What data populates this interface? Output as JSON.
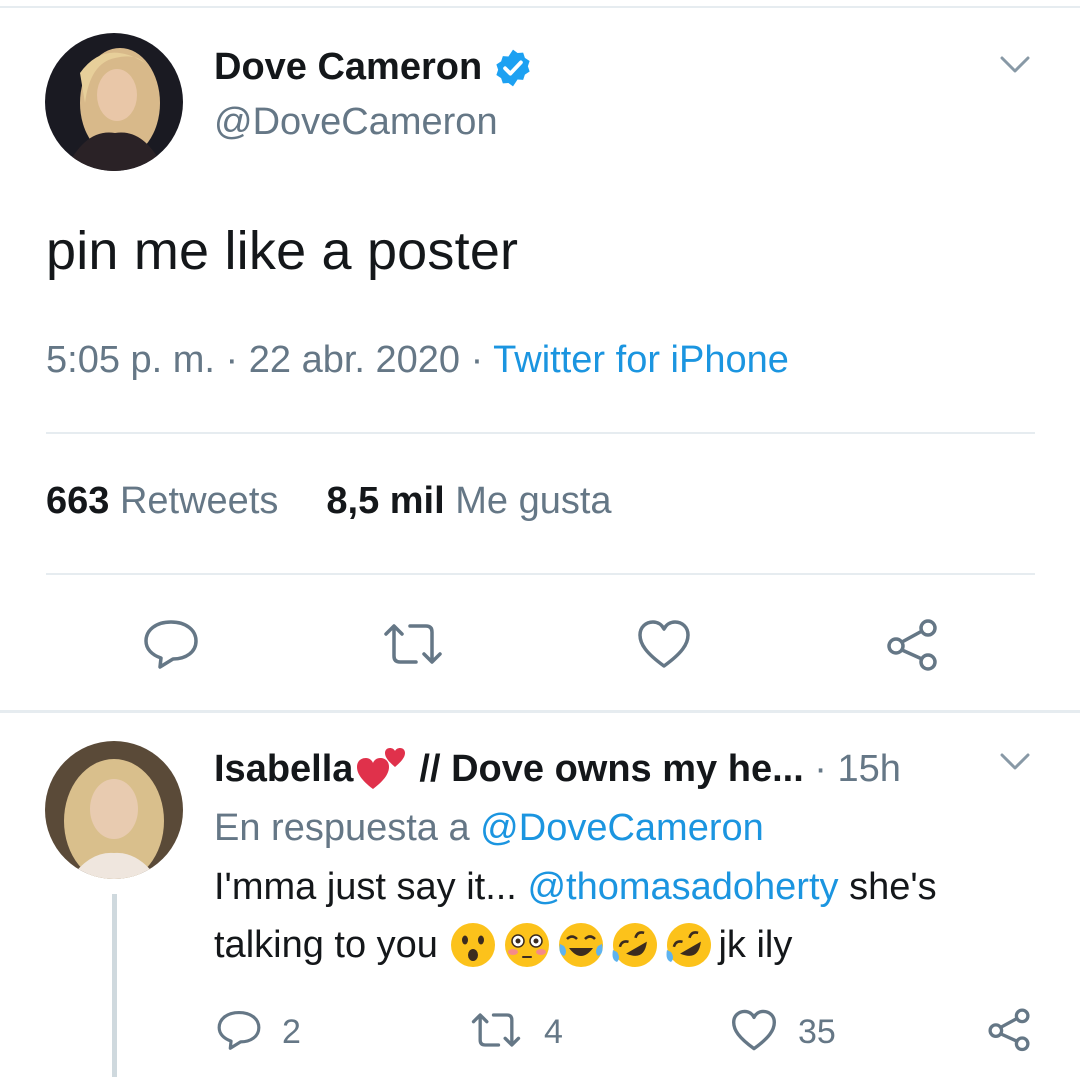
{
  "tweet": {
    "display_name": "Dove Cameron",
    "handle": "@DoveCameron",
    "text": "pin me like a poster",
    "time": "5:05 p. m.",
    "date": "22 abr. 2020",
    "source": "Twitter for iPhone",
    "retweet_count": "663",
    "retweet_label": "Retweets",
    "like_count": "8,5 mil",
    "like_label": "Me gusta",
    "icons": [
      "reply-icon",
      "retweet-icon",
      "like-icon",
      "share-icon",
      "verified-badge-icon",
      "chevron-down-icon"
    ]
  },
  "reply": {
    "display_name": "Isabella",
    "display_name_suffix": "// Dove owns my he...",
    "time": "15h",
    "reply_prefix": "En respuesta a",
    "reply_to": "@DoveCameron",
    "text_part1": "I'mma just say it...",
    "mention": "@thomasadoherty",
    "text_part2": "she's",
    "text_line2": "talking to you",
    "text_end": "jk ily",
    "emojis": [
      "hushed-face",
      "flushed-face",
      "tears-of-joy-face",
      "rofl-face",
      "rofl-face"
    ],
    "reply_count": "2",
    "retweet_count": "4",
    "like_count": "35"
  },
  "colors": {
    "text": "#14171a",
    "secondary": "#657786",
    "link": "#1b95e0",
    "divider": "#e6ecf0"
  }
}
